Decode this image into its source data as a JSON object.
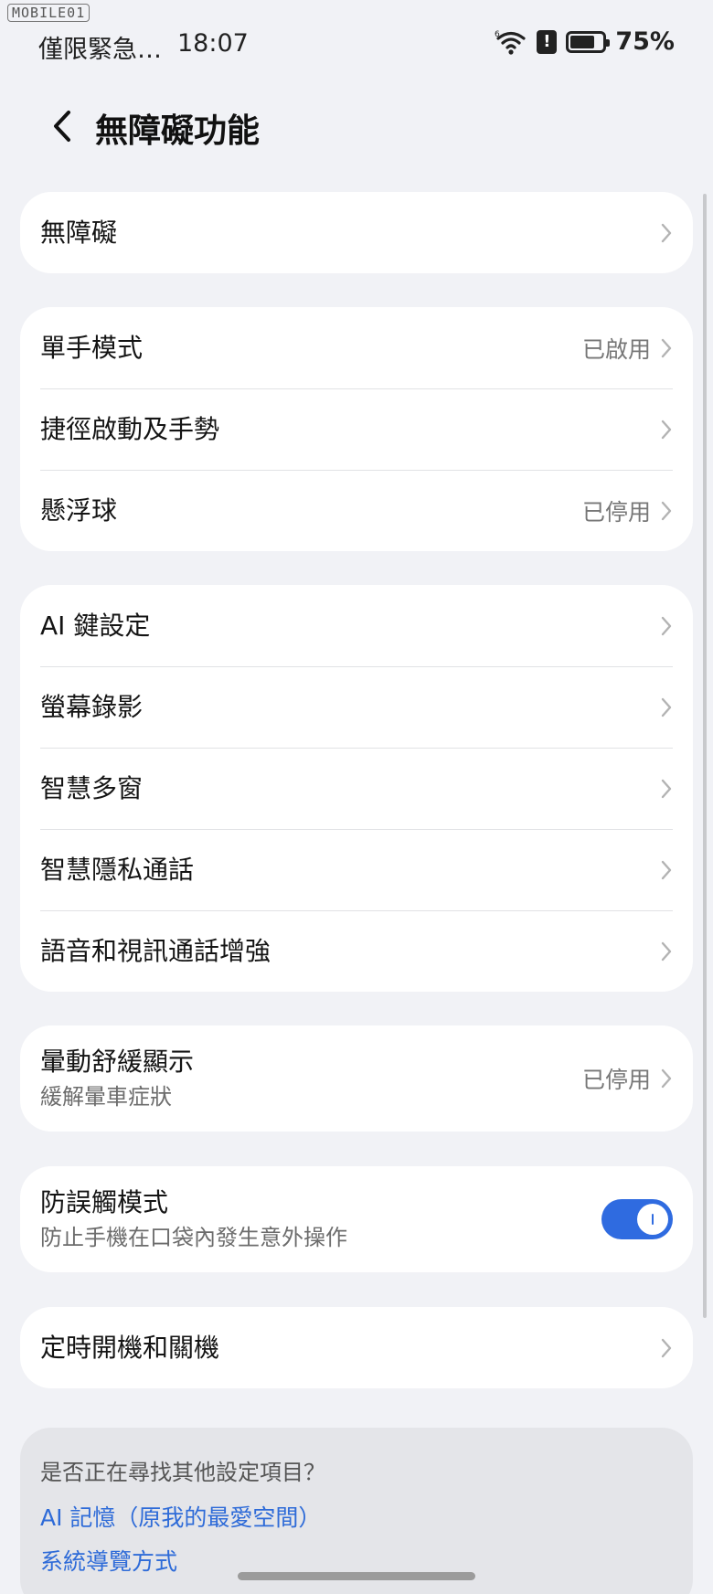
{
  "watermark": "MOBILE01",
  "status": {
    "carrier": "僅限緊急…",
    "time": "18:07",
    "battery_level": 0.75,
    "battery": "75%"
  },
  "header": {
    "title": "無障礙功能"
  },
  "groups": [
    {
      "items": [
        {
          "label": "無障礙"
        }
      ]
    },
    {
      "items": [
        {
          "label": "單手模式",
          "value": "已啟用"
        },
        {
          "label": "捷徑啟動及手勢"
        },
        {
          "label": "懸浮球",
          "value": "已停用"
        }
      ]
    },
    {
      "items": [
        {
          "label": "AI 鍵設定"
        },
        {
          "label": "螢幕錄影"
        },
        {
          "label": "智慧多窗"
        },
        {
          "label": "智慧隱私通話"
        },
        {
          "label": "語音和視訊通話增強"
        }
      ]
    },
    {
      "items": [
        {
          "label": "暈動舒緩顯示",
          "sub": "緩解暈車症狀",
          "value": "已停用"
        }
      ]
    },
    {
      "items": [
        {
          "label": "防誤觸模式",
          "sub": "防止手機在口袋內發生意外操作",
          "toggle": true
        }
      ]
    },
    {
      "items": [
        {
          "label": "定時開機和關機"
        }
      ]
    }
  ],
  "suggestions": {
    "title": "是否正在尋找其他設定項目？",
    "links": [
      "AI 記憶（原我的最愛空間）",
      "系統導覽方式"
    ]
  },
  "colors": {
    "accent": "#2f6be0",
    "link": "#2e6bd8",
    "background": "#f1f2f6"
  }
}
